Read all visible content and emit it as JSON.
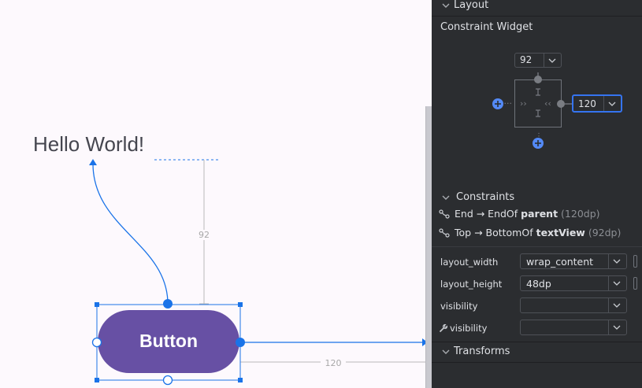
{
  "canvas": {
    "hello_text": "Hello World!",
    "button_label": "Button",
    "vertical_margin": "92",
    "horizontal_margin": "120",
    "accent": "#1a73e8",
    "button_color": "#6750a4"
  },
  "panel": {
    "layout_header": "Layout",
    "widget_title": "Constraint Widget",
    "top_margin_value": "92",
    "end_margin_value": "120",
    "constraints_header": "Constraints",
    "constraints": [
      {
        "prefix": "End → EndOf",
        "target": "parent",
        "margin": "(120dp)"
      },
      {
        "prefix": "Top → BottomOf",
        "target": "textView",
        "margin": "(92dp)"
      }
    ],
    "attributes": [
      {
        "label": "layout_width",
        "value": "wrap_content"
      },
      {
        "label": "layout_height",
        "value": "48dp"
      },
      {
        "label": "visibility",
        "value": ""
      },
      {
        "label": "visibility",
        "value": ""
      }
    ],
    "transforms_header": "Transforms",
    "focus_color": "#3574f0"
  }
}
